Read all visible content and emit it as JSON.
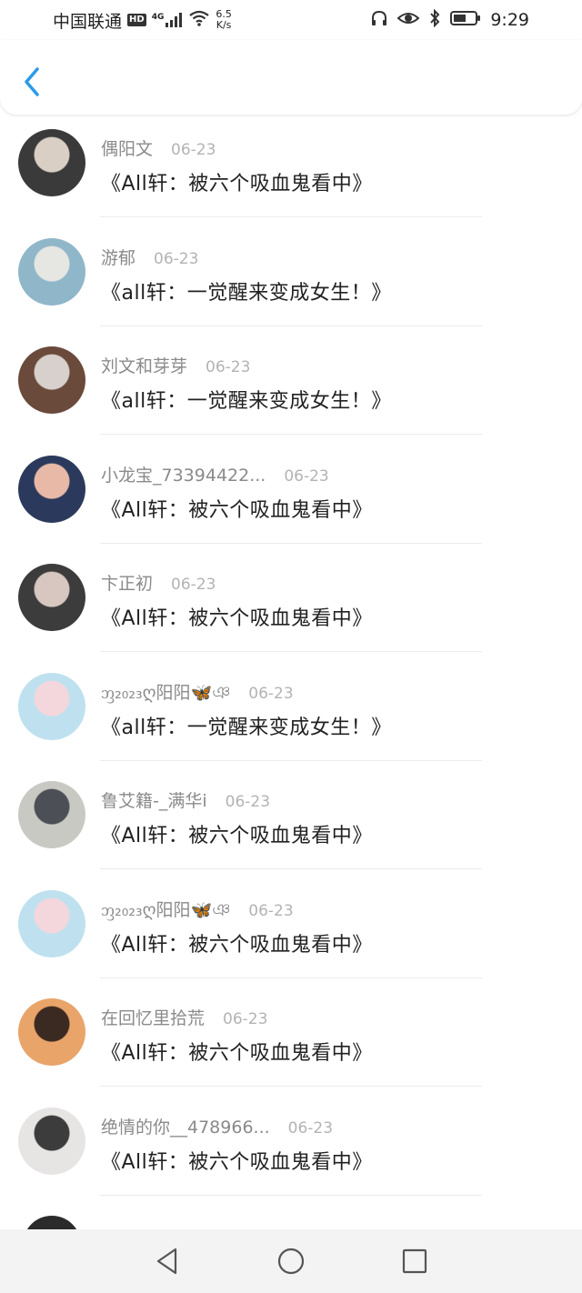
{
  "status": {
    "carrier": "中国联通",
    "hd": "HD",
    "signal": "4G",
    "speed_value": "6.5",
    "speed_unit": "K/s",
    "time": "9:29"
  },
  "nav": {
    "back_icon": "chevron-left-icon",
    "accent": "#2a9bea"
  },
  "items": [
    {
      "name": "偶阳文",
      "date": "06-23",
      "title": "《All轩：被六个吸血鬼看中》",
      "avatar_colors": [
        "#3a3a3a",
        "#d9cfc4"
      ]
    },
    {
      "name": "游郁",
      "date": "06-23",
      "title": "《all轩：一觉醒来变成女生！》",
      "avatar_colors": [
        "#8fb7c9",
        "#e6e6e2"
      ]
    },
    {
      "name": "刘文和芽芽",
      "date": "06-23",
      "title": "《all轩：一觉醒来变成女生！》",
      "avatar_colors": [
        "#6a4a3a",
        "#d8d0cc"
      ]
    },
    {
      "name": "小龙宝_73394422...",
      "date": "06-23",
      "title": "《All轩：被六个吸血鬼看中》",
      "avatar_colors": [
        "#2b3a5c",
        "#e9b9a7"
      ]
    },
    {
      "name": "卞正初",
      "date": "06-23",
      "title": "《All轩：被六个吸血鬼看中》",
      "avatar_colors": [
        "#3c3c3c",
        "#d7c7c0"
      ]
    },
    {
      "name": "ᦀ₂₀₂₃ღ阳阳🦋ঞ",
      "date": "06-23",
      "title": "《all轩：一觉醒来变成女生！》",
      "avatar_colors": [
        "#bfe1ef",
        "#f3d7dc"
      ]
    },
    {
      "name": "鲁艾籍-_满华i",
      "date": "06-23",
      "title": "《All轩：被六个吸血鬼看中》",
      "avatar_colors": [
        "#c9c9c4",
        "#4c4f55"
      ]
    },
    {
      "name": "ᦀ₂₀₂₃ღ阳阳🦋ঞ",
      "date": "06-23",
      "title": "《All轩：被六个吸血鬼看中》",
      "avatar_colors": [
        "#bfe1ef",
        "#f3d7dc"
      ]
    },
    {
      "name": "在回忆里拾荒",
      "date": "06-23",
      "title": "《All轩：被六个吸血鬼看中》",
      "avatar_colors": [
        "#e9a46a",
        "#3a2a22"
      ]
    },
    {
      "name": "绝情的你__478966...",
      "date": "06-23",
      "title": "《All轩：被六个吸血鬼看中》",
      "avatar_colors": [
        "#e7e4e4",
        "#3c3c3c"
      ]
    }
  ],
  "bottom_nav": {
    "back_icon": "triangle-back-icon",
    "home_icon": "circle-home-icon",
    "recent_icon": "square-recent-icon"
  }
}
